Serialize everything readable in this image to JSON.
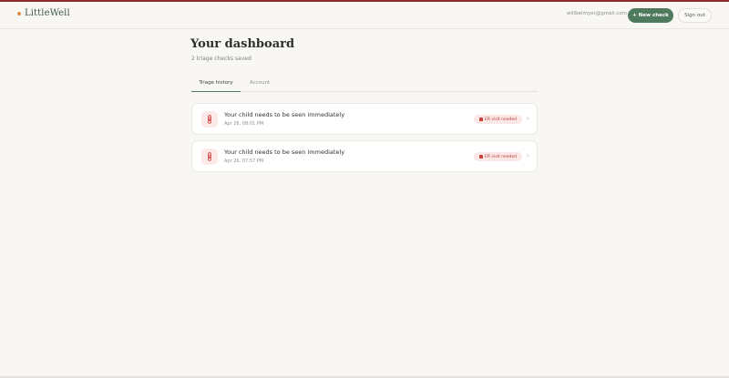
{
  "header": {
    "brand": "LittleWell",
    "user_email": "willbelmyer@gmail.com",
    "new_check_label": "+ New check",
    "sign_out_label": "Sign out"
  },
  "page": {
    "title": "Your dashboard",
    "subtitle": "2 triage checks saved"
  },
  "tabs": [
    {
      "label": "Triage history",
      "active": true
    },
    {
      "label": "Account",
      "active": false
    }
  ],
  "checks": [
    {
      "title": "Your child needs to be seen immediately",
      "time": "Apr 26, 08:01 PM",
      "badge": "ER visit needed",
      "icon": "thermometer-icon"
    },
    {
      "title": "Your child needs to be seen immediately",
      "time": "Apr 26, 07:57 PM",
      "badge": "ER visit needed",
      "icon": "thermometer-icon"
    }
  ],
  "colors": {
    "accent": "#4f7a5e",
    "alert": "#b53c3c",
    "background": "#f8f7f3"
  }
}
